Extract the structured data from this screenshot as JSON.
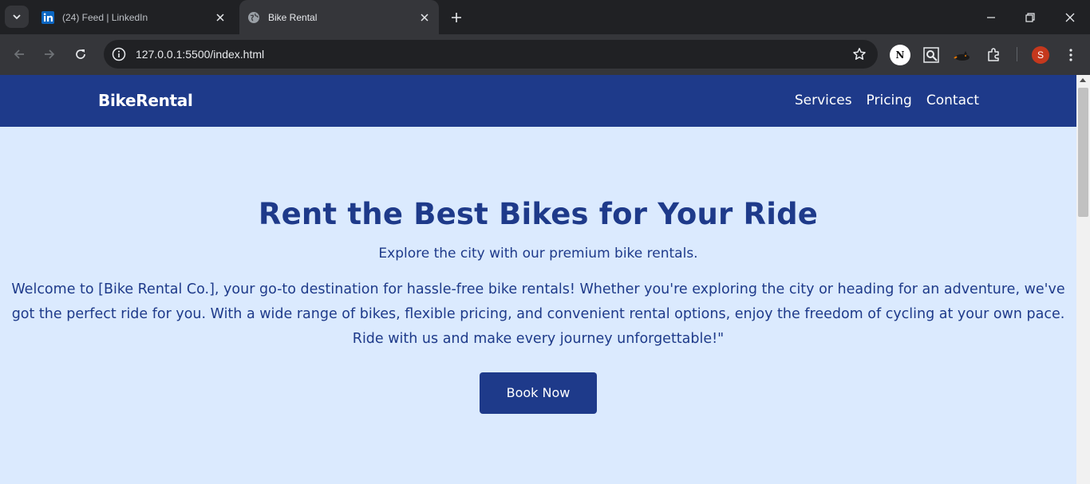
{
  "browser": {
    "tabs": [
      {
        "title": "(24) Feed | LinkedIn",
        "icon": "linkedin-icon",
        "active": false
      },
      {
        "title": "Bike Rental",
        "icon": "globe-icon",
        "active": true
      }
    ],
    "url": "127.0.0.1:5500/index.html",
    "extensions": [
      "notion-web-clipper-icon",
      "search-scan-icon",
      "cat-extension-icon",
      "puzzle-extensions-icon"
    ],
    "profile_initial": "S",
    "ext_n_label": "N",
    "colors": {
      "frame": "#202124",
      "toolbar": "#35363a",
      "profile": "#c5381d",
      "linkedin": "#0a66c2"
    }
  },
  "site": {
    "brand": "BikeRental",
    "nav": [
      "Services",
      "Pricing",
      "Contact"
    ],
    "hero": {
      "title": "Rent the Best Bikes for Your Ride",
      "tagline": "Explore the city with our premium bike rentals.",
      "description": "Welcome to [Bike Rental Co.], your go-to destination for hassle-free bike rentals! Whether you're exploring the city or heading for an adventure, we've got the perfect ride for you. With a wide range of bikes, flexible pricing, and convenient rental options, enjoy the freedom of cycling at your own pace. Ride with us and make every journey unforgettable!\"",
      "cta": "Book Now"
    },
    "colors": {
      "primary": "#1e3a8a",
      "background": "#dbeafe",
      "text_on_primary": "#ffffff"
    }
  }
}
